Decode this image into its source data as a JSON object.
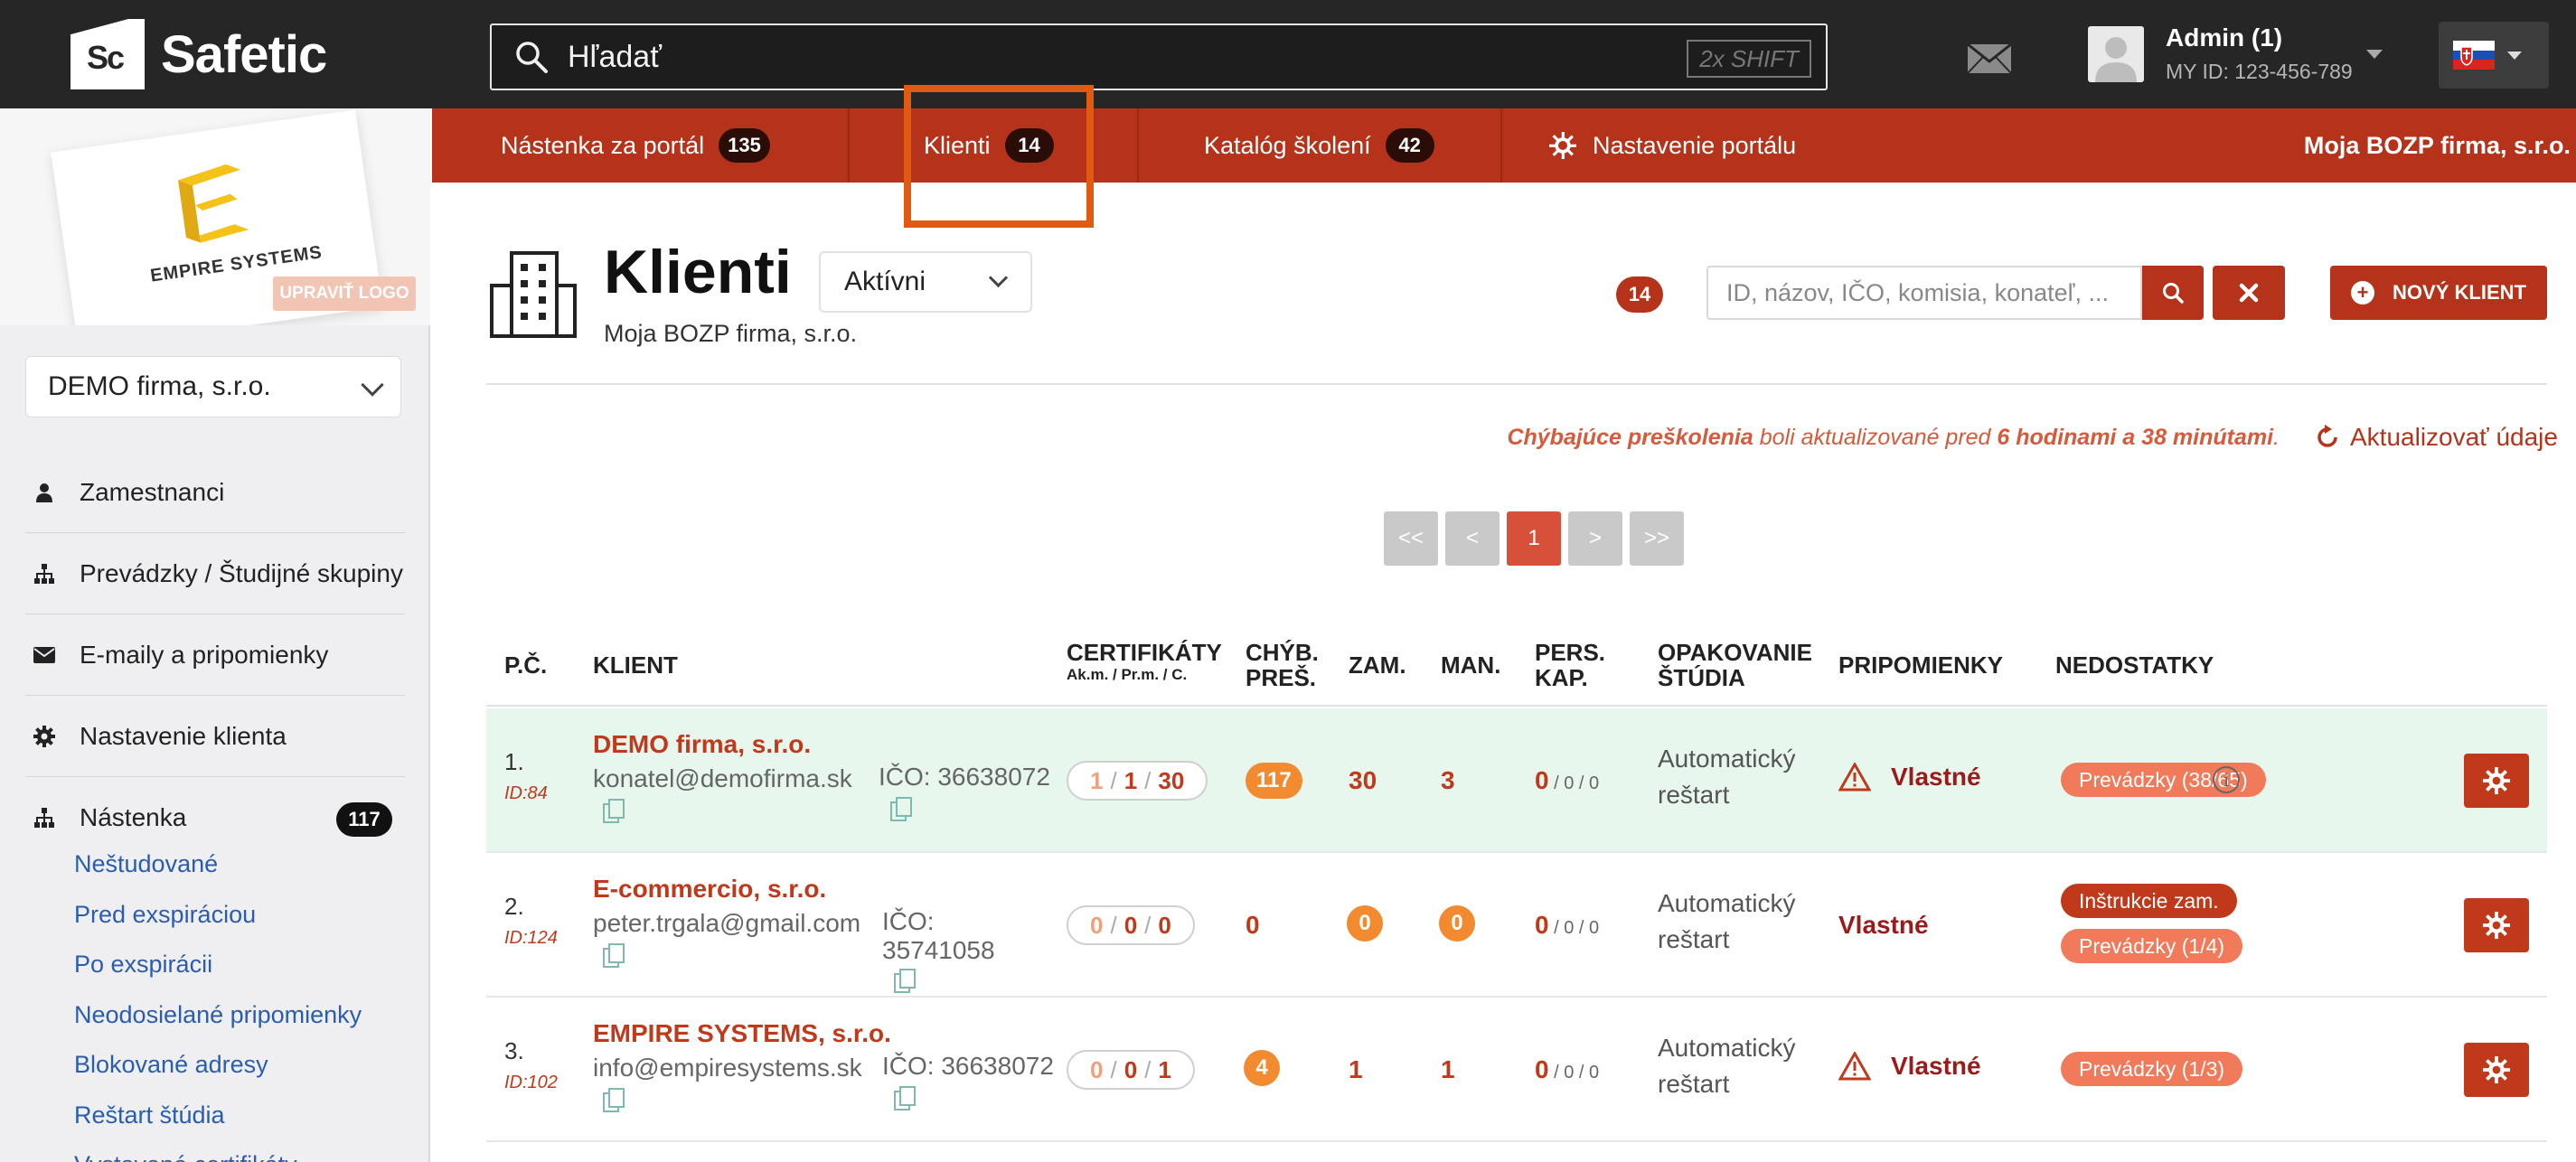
{
  "app": {
    "brand": "Safetic",
    "brand_mark": "Sc"
  },
  "search": {
    "placeholder": "Hľadať",
    "shortcut": "2x SHIFT"
  },
  "user": {
    "name": "Admin (1)",
    "id_label": "MY ID: 123-456-789"
  },
  "sidebar": {
    "logo_brand": "EMPIRE SYSTEMS",
    "upload_logo": "UPRAVIŤ LOGO",
    "company": "DEMO firma, s.r.o.",
    "items": [
      {
        "label": "Zamestnanci",
        "icon": "person-icon"
      },
      {
        "label": "Prevádzky / Študijné skupiny",
        "icon": "org-icon"
      },
      {
        "label": "E-maily a pripomienky",
        "icon": "envelope-icon"
      },
      {
        "label": "Nastavenie klienta",
        "icon": "gear-icon"
      },
      {
        "label": "Nástenka",
        "icon": "org-icon",
        "count": "117"
      }
    ],
    "subitems": [
      "Neštudované",
      "Pred exspiráciou",
      "Po exspirácii",
      "Neodosielané pripomienky",
      "Blokované adresy",
      "Reštart štúdia",
      "Vystavené certifikáty"
    ]
  },
  "mainnav": {
    "tabs": [
      {
        "label": "Nástenka za portál",
        "badge": "135"
      },
      {
        "label": "Klienti",
        "badge": "14"
      },
      {
        "label": "Katalóg školení",
        "badge": "42"
      },
      {
        "label": "Nastavenie portálu"
      }
    ],
    "firm": "Moja BOZP firma, s.r.o."
  },
  "header": {
    "title": "Klienti",
    "subtitle": "Moja BOZP firma, s.r.o.",
    "status": "Aktívni",
    "count": "14",
    "search_placeholder": "ID, názov, IČO, komisia, konateľ, ...",
    "new_client": "NOVÝ KLIENT"
  },
  "update": {
    "lead": "Chýbajúce preškolenia",
    "middle": " boli aktualizované pred ",
    "age": "6 hodinami a 38 minútami",
    "tail": ".",
    "button": "Aktualizovať údaje"
  },
  "pager": {
    "first": "<<",
    "prev": "<",
    "current": "1",
    "next": ">",
    "last": ">>"
  },
  "table": {
    "columns": {
      "num": "P.Č.",
      "client": "KLIENT",
      "certs": "CERTIFIKÁTY",
      "certs_sub": "Ak.m. / Pr.m. / C.",
      "missing": "CHÝB.\nPREŠ.",
      "emp": "ZAM.",
      "man": "MAN.",
      "pers": "PERS.\nKAP.",
      "repeat": "OPAKOVANIE\nŠTÚDIA",
      "remind": "PRIPOMIENKY",
      "defects": "NEDOSTATKY"
    },
    "rows": [
      {
        "num": "1.",
        "id": "ID:84",
        "name": "DEMO firma, s.r.o.",
        "email": "konatel@demofirma.sk",
        "ico": "IČO: 36638072",
        "cert": [
          "1",
          "1",
          "30"
        ],
        "missing": "117",
        "emp": "30",
        "man": "3",
        "pers_main": "0",
        "pers_rest": " / 0 / 0",
        "restart": "Automatický reštart",
        "remind": "Vlastné",
        "defects": [
          "Prevádzky (38/65)"
        ]
      },
      {
        "num": "2.",
        "id": "ID:124",
        "name": "E-commercio, s.r.o.",
        "email": "peter.trgala@gmail.com",
        "ico": "IČO: 35741058",
        "cert": [
          "0",
          "0",
          "0"
        ],
        "missing": "0",
        "emp": "0",
        "man": "0",
        "pers_main": "0",
        "pers_rest": " / 0 / 0",
        "restart": "Automatický reštart",
        "remind": "Vlastné",
        "defects": [
          "Inštrukcie zam.",
          "Prevádzky (1/4)"
        ]
      },
      {
        "num": "3.",
        "id": "ID:102",
        "name": "EMPIRE SYSTEMS, s.r.o.",
        "email": "info@empiresystems.sk",
        "ico": "IČO: 36638072",
        "cert": [
          "0",
          "0",
          "1"
        ],
        "missing": "4",
        "emp": "1",
        "man": "1",
        "pers_main": "0",
        "pers_rest": " / 0 / 0",
        "restart": "Automatický reštart",
        "remind": "Vlastné",
        "defects": [
          "Prevádzky (1/3)"
        ]
      }
    ]
  },
  "colors": {
    "brand": "#b4331a",
    "topbar": "#262626",
    "highlight_row": "#e7f7ee",
    "annotation": "#e05a12"
  }
}
